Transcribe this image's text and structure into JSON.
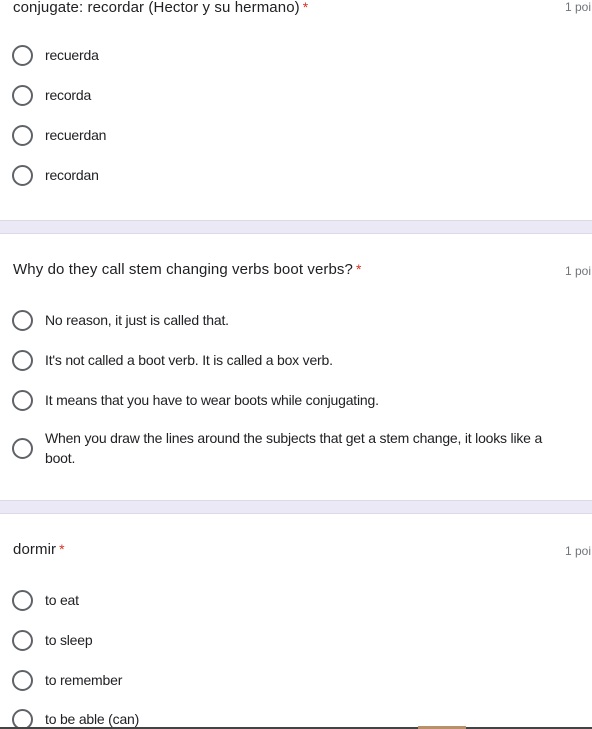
{
  "questions": [
    {
      "title": "conjugate: recordar (Hector y su hermano)",
      "required_mark": "*",
      "points": "1 poi",
      "options": [
        "recuerda",
        "recorda",
        "recuerdan",
        "recordan"
      ]
    },
    {
      "title": "Why do they call stem changing verbs boot verbs?",
      "required_mark": "*",
      "points": "1 poi",
      "options": [
        "No reason, it just is called that.",
        "It's not called a boot verb. It is called a box verb.",
        "It means that you have to wear boots while conjugating.",
        "When you draw the lines around the subjects that get a stem change, it looks like a boot."
      ]
    },
    {
      "title": "dormir",
      "required_mark": "*",
      "points": "1 poi",
      "options": [
        "to eat",
        "to sleep",
        "to remember",
        "to be able (can)"
      ]
    }
  ],
  "colors": {
    "required": "#d93025",
    "separator": "#ebe9f5",
    "radio_border": "#5f6368"
  }
}
